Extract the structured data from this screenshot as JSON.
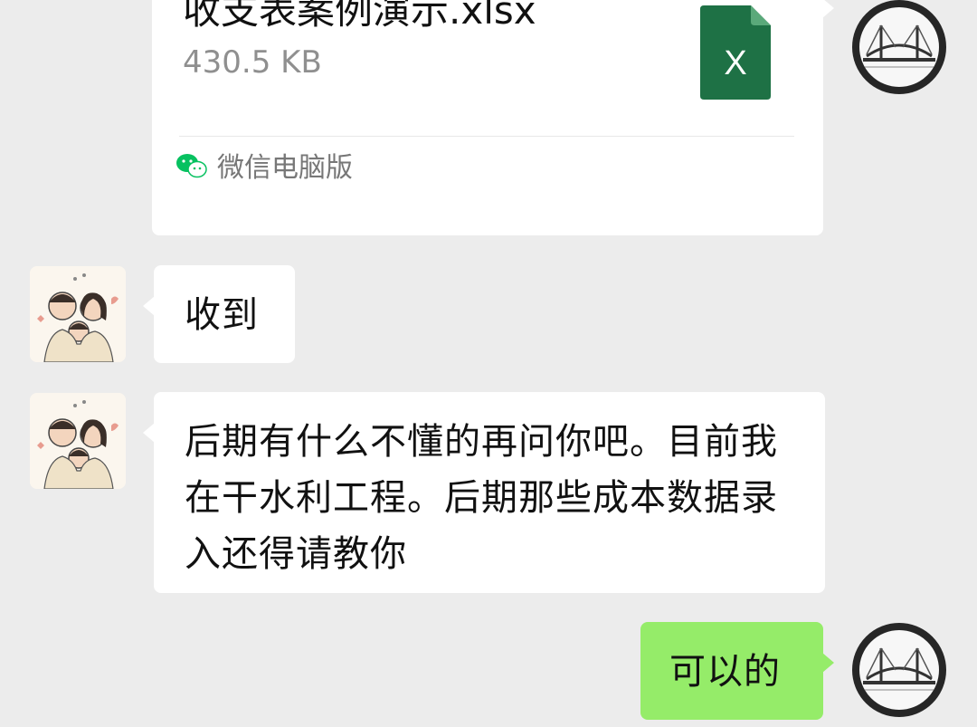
{
  "messages": {
    "file": {
      "name": "收支表案例演示.xlsx",
      "size": "430.5 KB",
      "icon": "excel-file-icon",
      "icon_letter": "X",
      "icon_color": "#1e7145",
      "source": "微信电脑版"
    },
    "msg1": {
      "text": "收到"
    },
    "msg2": {
      "text": "后期有什么不懂的再问你吧。目前我在干水利工程。后期那些成本数据录入还得请教你"
    },
    "msg3": {
      "text": "可以的"
    }
  },
  "avatars": {
    "self": "bridge-avatar-icon",
    "peer": "family-cartoon-avatar"
  },
  "colors": {
    "background": "#ececec",
    "incoming_bubble": "#ffffff",
    "outgoing_bubble": "#95ec69",
    "wechat_green": "#07c160"
  }
}
